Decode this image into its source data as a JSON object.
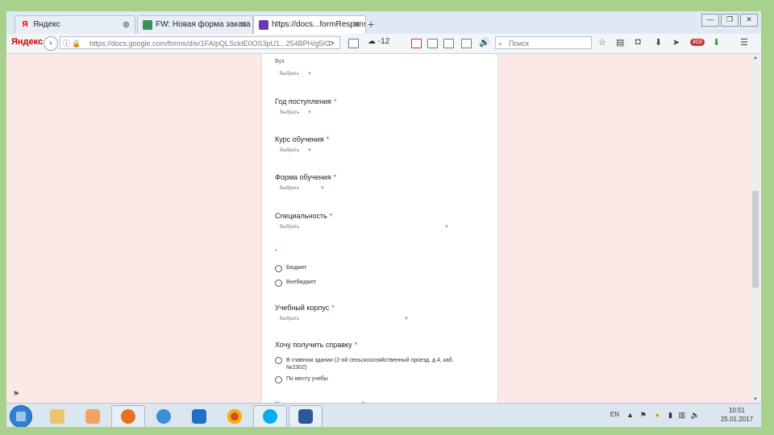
{
  "tabs": [
    {
      "label": "Яндекс",
      "close": "⊗"
    },
    {
      "label": "FW: Новая форма заказа ...",
      "close": "✕"
    },
    {
      "label": "https://docs...formResponse",
      "close": "✕"
    }
  ],
  "new_tab": "+",
  "window_buttons": [
    "—",
    "❐",
    "✕"
  ],
  "toolbar": {
    "brand": "Яндекс",
    "back": "‹",
    "url": "https://docs.google.com/forms/d/e/1FAIpQLSckIE0OS3pU1...254BPH/g5IC",
    "reload": "⟳",
    "weather": "-12",
    "search_placeholder": "Поиск",
    "badge": "403"
  },
  "form": {
    "partial_label": "Вуз",
    "questions": [
      {
        "label": "Год поступления",
        "required": "*",
        "placeholder": "Выбрать"
      },
      {
        "label": "Курс обучения",
        "required": "*",
        "placeholder": "Выбрать"
      },
      {
        "label": "Форма обучения",
        "required": "*",
        "placeholder": "Выбрать"
      },
      {
        "label": "Специальность",
        "required": "*",
        "placeholder": "Выбрать"
      }
    ],
    "unnamed_required": "*",
    "budget_options": [
      "Бюджет",
      "Внебюджет"
    ],
    "building": {
      "label": "Учебный корпус",
      "required": "*",
      "placeholder": "Выбрать"
    },
    "certificate": {
      "label": "Хочу получить справку",
      "required": "*",
      "options": [
        "В главном здании (2-ой сельскохозяйственный проезд, д.4, каб. №2302)",
        "По месту учебы"
      ]
    },
    "copies": {
      "label": "Количество экземпляров",
      "required": "*"
    }
  },
  "taskbar": {
    "lang": "EN",
    "time": "10:51",
    "date": "25.01.2017"
  },
  "colors": {
    "background": "#fce9e7",
    "frame": "#a9d18e",
    "required_star": "#d93025"
  }
}
